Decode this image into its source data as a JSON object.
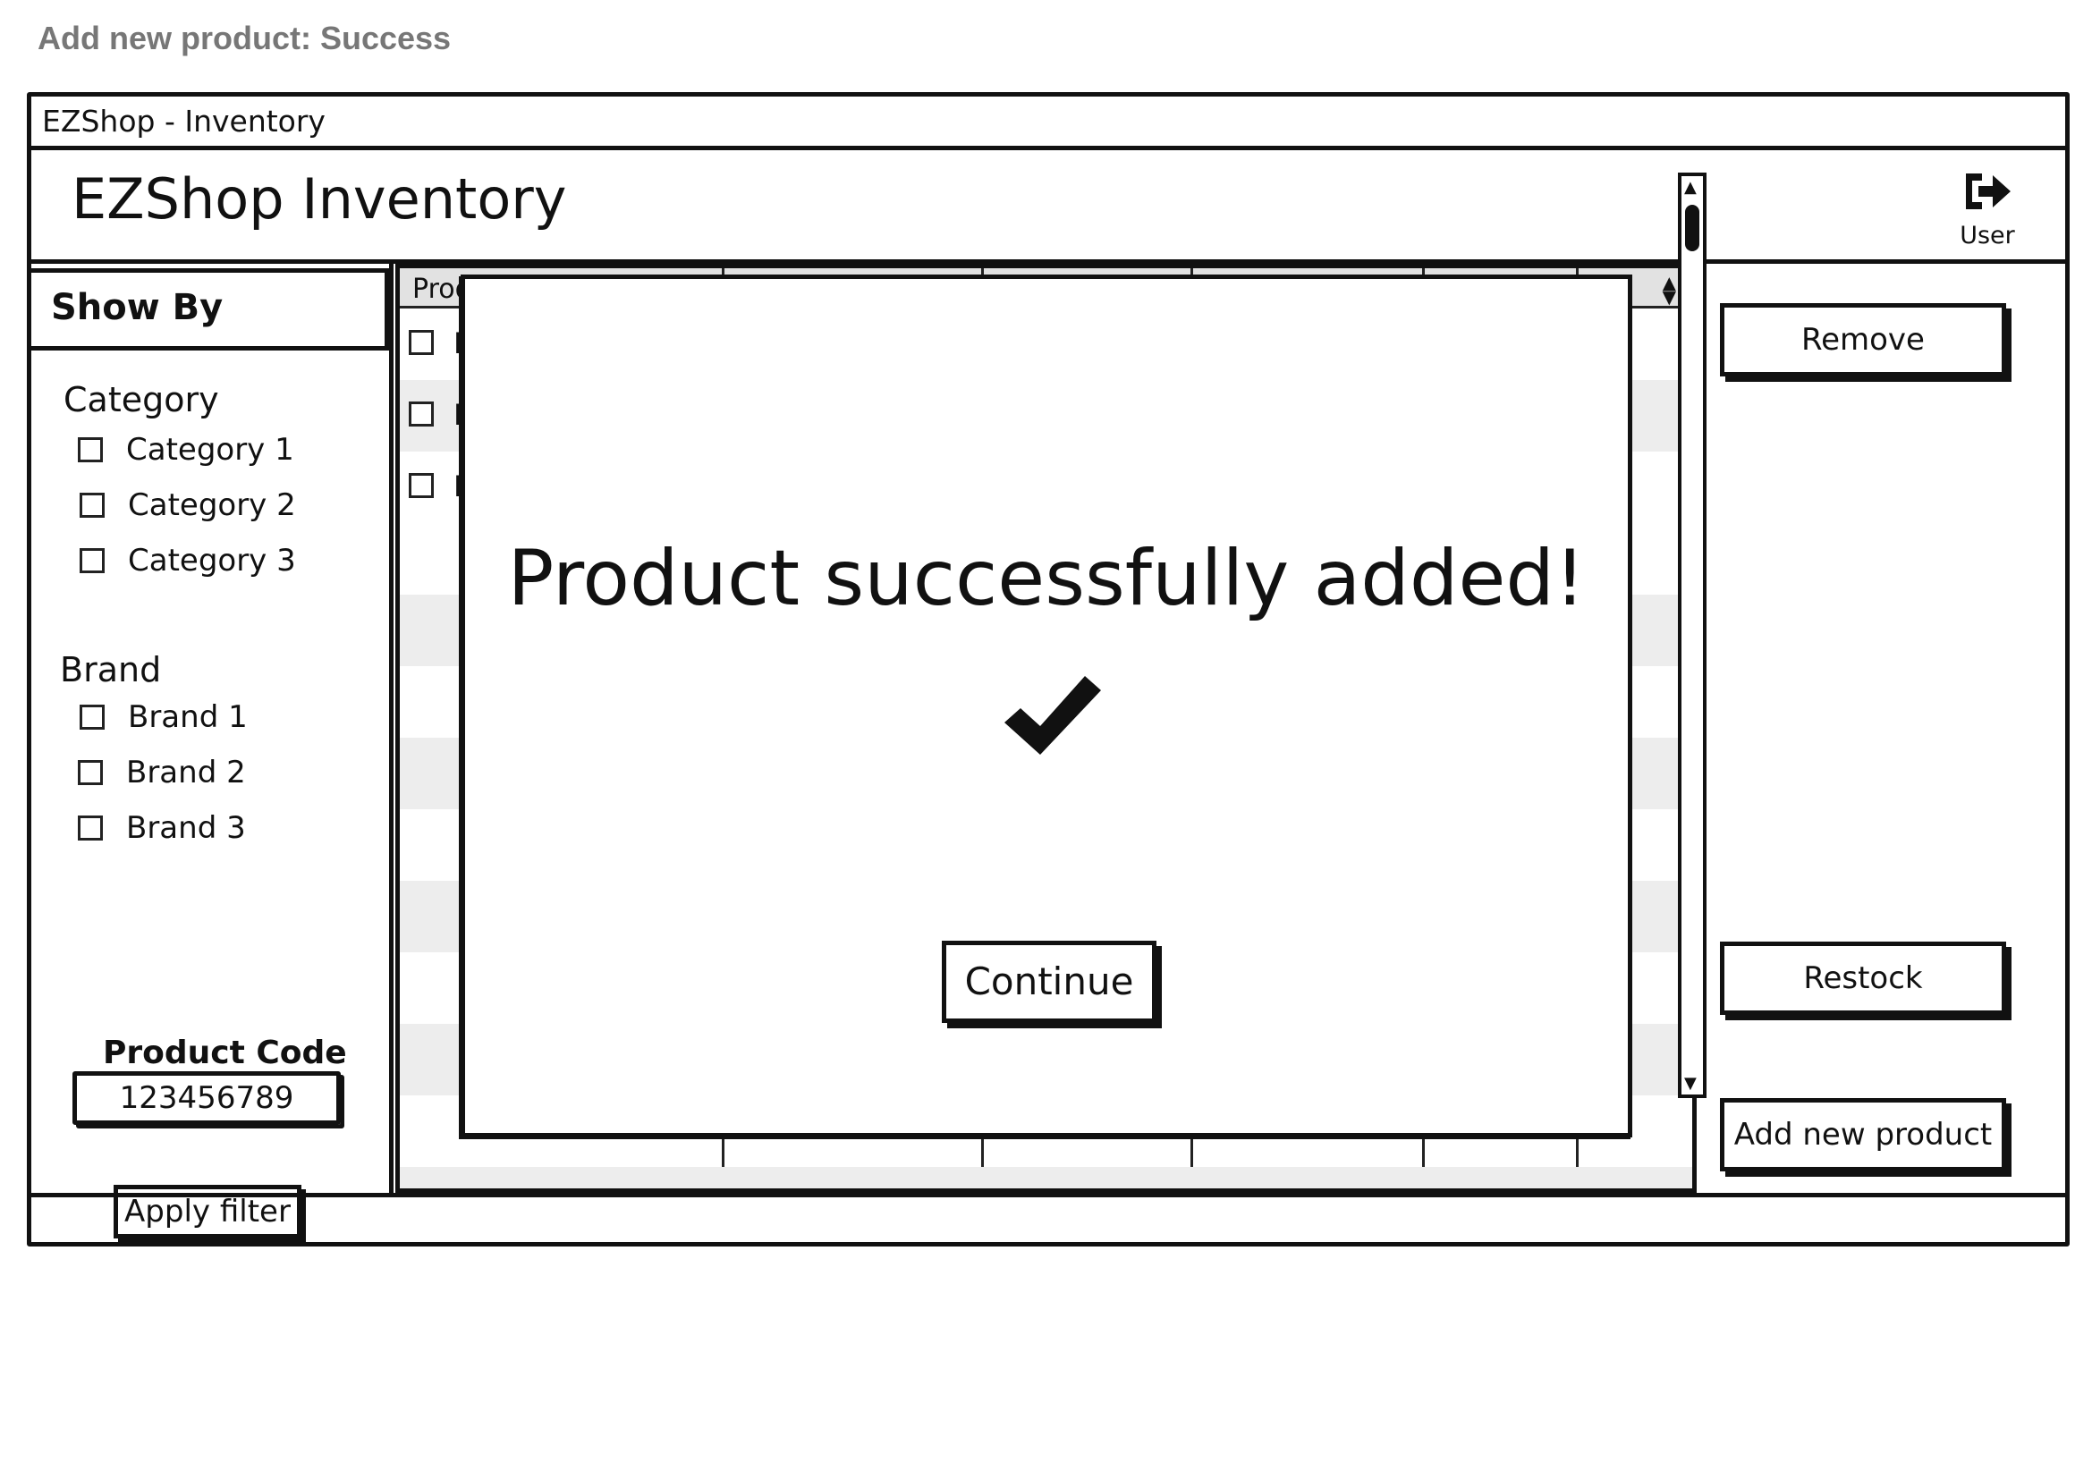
{
  "caption": "Add new product: Success",
  "window": {
    "title": "EZShop - Inventory"
  },
  "header": {
    "app_title": "EZShop Inventory",
    "user_label": "User",
    "user_icon": "sign-out-icon"
  },
  "sidebar": {
    "show_by": "Show By",
    "category_title": "Category",
    "categories": [
      "Category 1",
      "Category 2",
      "Category 3"
    ],
    "brand_title": "Brand",
    "brands": [
      "Brand 1",
      "Brand 2",
      "Brand 3"
    ],
    "product_code_label": "Product Code",
    "product_code_value": "123456789",
    "apply_label": "Apply filter"
  },
  "table": {
    "headers": [
      "Prod",
      "",
      "",
      "",
      "",
      ""
    ],
    "visible_row_cells": [
      "P",
      "P",
      "P"
    ]
  },
  "actions": {
    "remove": "Remove",
    "restock": "Restock",
    "add_new": "Add new product"
  },
  "modal": {
    "message": "Product successfully added!",
    "icon": "checkmark-icon",
    "continue_label": "Continue"
  }
}
